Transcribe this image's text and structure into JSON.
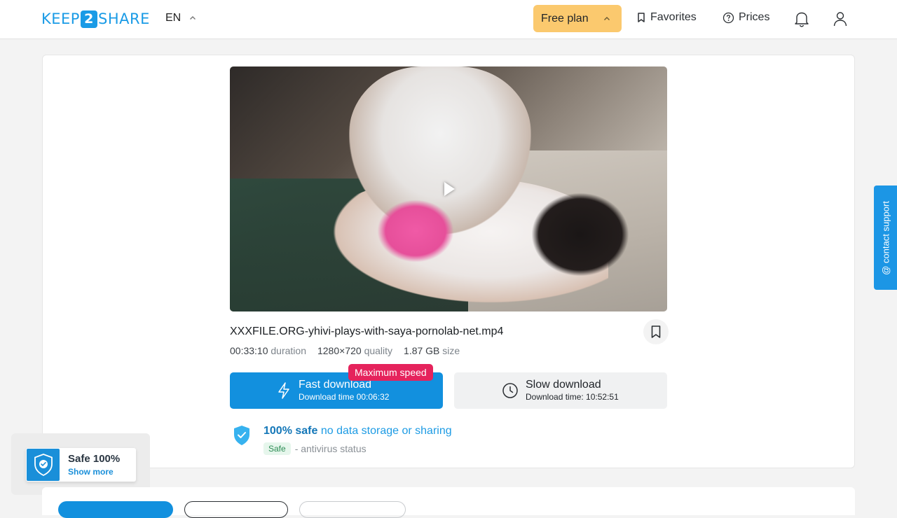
{
  "header": {
    "logo_left": "KEEP",
    "logo_mid": "2",
    "logo_right": "SHARE",
    "language": "EN",
    "plan_label": "Free plan",
    "favorites_label": "Favorites",
    "prices_label": "Prices"
  },
  "file": {
    "name": "XXXFILE.ORG-yhivi-plays-with-saya-pornolab-net.mp4",
    "duration_value": "00:33:10",
    "duration_label": "duration",
    "quality_value": "1280×720",
    "quality_label": "quality",
    "size_value": "1.87 GB",
    "size_label": "size"
  },
  "download": {
    "badge": "Maximum speed",
    "fast_title": "Fast download",
    "fast_sub": "Download time 00:06:32",
    "slow_title": "Slow download",
    "slow_sub": "Download time: 10:52:51"
  },
  "safety": {
    "bold": "100% safe",
    "rest": "no data storage or sharing",
    "pill": "Safe",
    "status": "- antivirus status"
  },
  "support_tab": "@ contact support",
  "safe_widget": {
    "title": "Safe 100%",
    "link": "Show more"
  },
  "colors": {
    "accent": "#1290de",
    "plan": "#fbc96e",
    "badge": "#e5235c"
  }
}
